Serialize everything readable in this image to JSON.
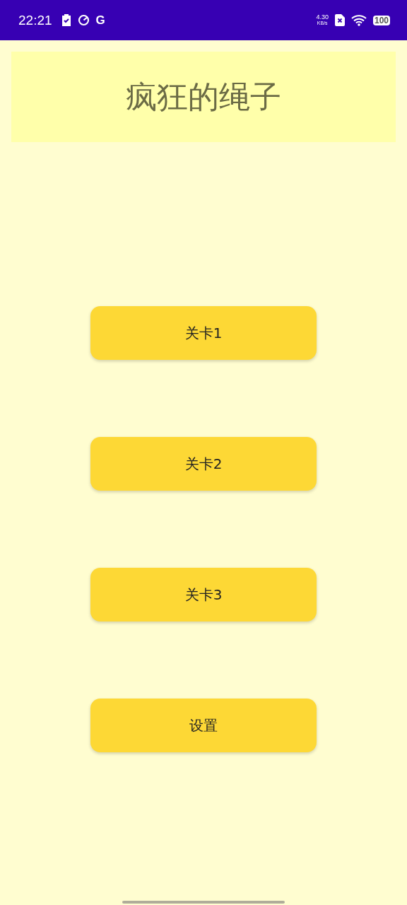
{
  "status_bar": {
    "time": "22:21",
    "google_letter": "G",
    "speed_value": "4.30",
    "speed_unit": "KB/s",
    "battery": "100"
  },
  "header": {
    "title": "疯狂的绳子"
  },
  "buttons": [
    {
      "label": "关卡1"
    },
    {
      "label": "关卡2"
    },
    {
      "label": "关卡3"
    },
    {
      "label": "设置"
    }
  ]
}
